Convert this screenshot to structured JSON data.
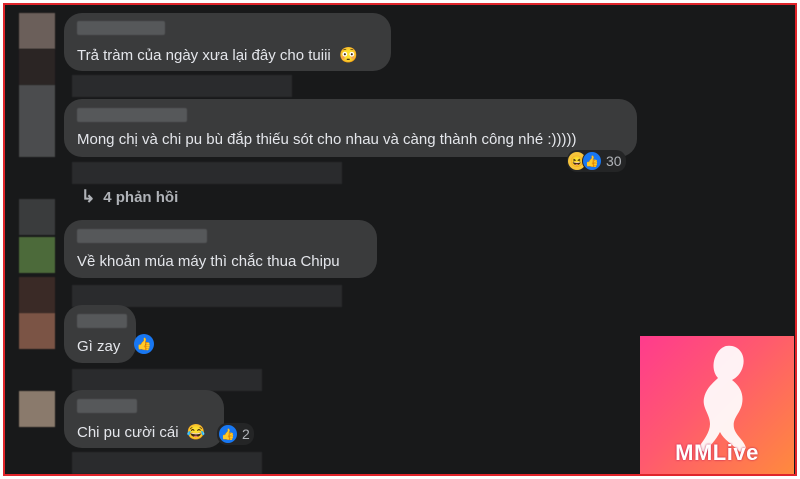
{
  "comments": [
    {
      "text": "Trả tràm của ngày xưa lại đây cho tuiii",
      "emoji": "😳"
    },
    {
      "text": "Mong chị và chi pu bù đắp thiếu sót cho nhau và càng thành công nhé :)))))",
      "reaction_count": "30"
    },
    {
      "text": "Về khoản múa máy thì chắc thua Chipu"
    },
    {
      "text": "Gì zay"
    },
    {
      "text": "Chi pu cười cái",
      "emoji": "😂",
      "reaction_count": "2"
    }
  ],
  "replies": {
    "label": "4 phản hồi"
  },
  "logo": {
    "text": "MMLive"
  },
  "colors": {
    "frame_border": "#e0252b",
    "background": "#18191a",
    "bubble": "#3a3b3c",
    "like": "#1877f2"
  }
}
